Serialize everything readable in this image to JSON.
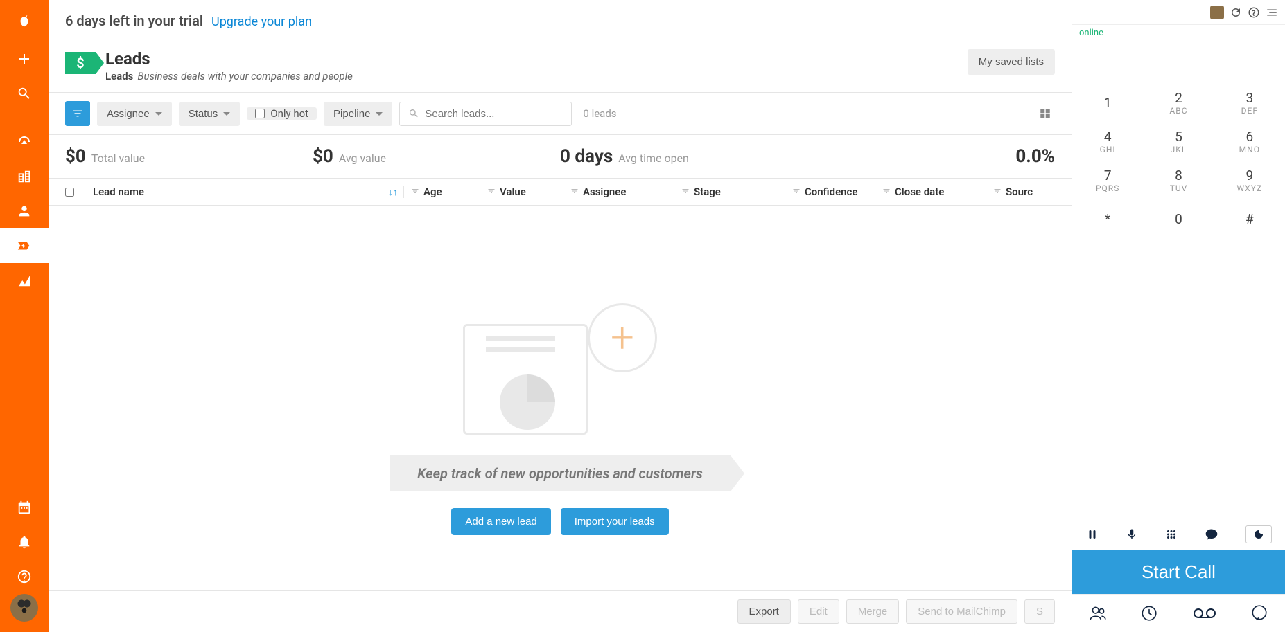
{
  "trial": {
    "text": "6 days left in your trial",
    "upgrade": "Upgrade your plan"
  },
  "page": {
    "title": "Leads",
    "subtitle_bold": "Leads",
    "subtitle": "Business deals with your companies and people",
    "saved_lists": "My saved lists"
  },
  "filters": {
    "assignee": "Assignee",
    "status": "Status",
    "only_hot": "Only hot",
    "pipeline": "Pipeline",
    "search_placeholder": "Search leads...",
    "count": "0 leads"
  },
  "stats": {
    "total": {
      "value": "$0",
      "label": "Total value"
    },
    "avg": {
      "value": "$0",
      "label": "Avg value"
    },
    "time": {
      "value": "0 days",
      "label": "Avg time open"
    },
    "pct": {
      "value": "0.0%"
    }
  },
  "columns": {
    "name": "Lead name",
    "age": "Age",
    "value": "Value",
    "assignee": "Assignee",
    "stage": "Stage",
    "confidence": "Confidence",
    "close": "Close date",
    "source": "Sourc"
  },
  "empty": {
    "banner": "Keep track of new opportunities and customers",
    "add": "Add a new lead",
    "import": "Import your leads"
  },
  "footer": {
    "export": "Export",
    "edit": "Edit",
    "merge": "Merge",
    "mailchimp": "Send to MailChimp",
    "s": "S"
  },
  "dialer": {
    "status": "online",
    "start": "Start Call",
    "keys": [
      {
        "d": "1",
        "l": ""
      },
      {
        "d": "2",
        "l": "ABC"
      },
      {
        "d": "3",
        "l": "DEF"
      },
      {
        "d": "4",
        "l": "GHI"
      },
      {
        "d": "5",
        "l": "JKL"
      },
      {
        "d": "6",
        "l": "MNO"
      },
      {
        "d": "7",
        "l": "PQRS"
      },
      {
        "d": "8",
        "l": "TUV"
      },
      {
        "d": "9",
        "l": "WXYZ"
      },
      {
        "d": "*",
        "l": ""
      },
      {
        "d": "0",
        "l": ""
      },
      {
        "d": "#",
        "l": ""
      }
    ]
  }
}
